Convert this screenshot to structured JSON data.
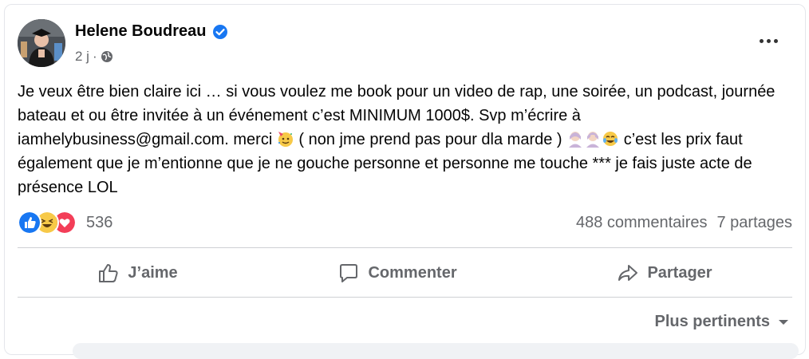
{
  "post": {
    "author": "Helene Boudreau",
    "time": "2 j",
    "separator": "·",
    "text_parts": [
      "Je veux être bien claire ici … si vous voulez me book pour un video de rap, une soirée, un podcast, journée bateau et ou être invitée à un événement c’est MINIMUM 1000$. Svp m’écrire à iamhelybusiness@gmail.com. merci ",
      " ( non jme prend pas pour dla marde ) ",
      " c’est les prix faut également que je m’entionne que je ne gouche personne et personne me touche *** je fais juste acte de présence LOL"
    ]
  },
  "reactions": {
    "count": "536",
    "icons": [
      "like-reaction",
      "haha-reaction",
      "love-reaction"
    ]
  },
  "stats": {
    "comments": "488 commentaires",
    "shares": "7 partages"
  },
  "actions": {
    "like": "J’aime",
    "comment": "Commenter",
    "share": "Partager"
  },
  "sort": {
    "label": "Plus pertinents"
  },
  "colors": {
    "like_blue": "#1877f2",
    "love_red": "#f33e58",
    "haha_yellow": "#f7c948",
    "muted_text": "#65676b"
  }
}
